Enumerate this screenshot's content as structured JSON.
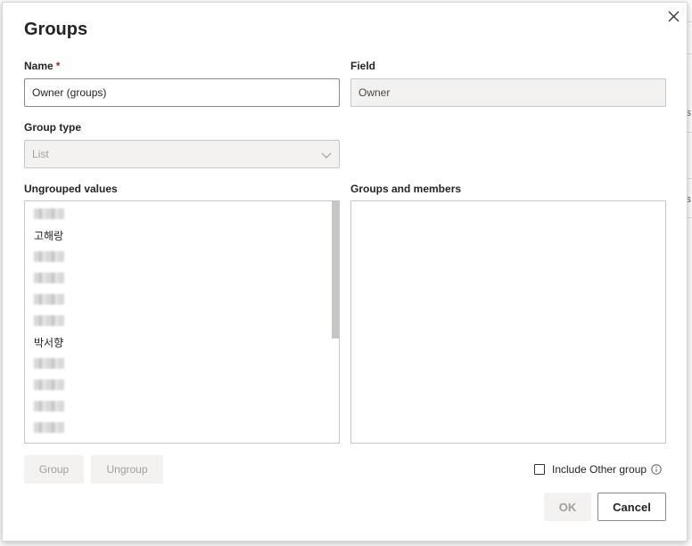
{
  "background": {
    "fragments": [
      "s",
      "s"
    ]
  },
  "dialog": {
    "title": "Groups",
    "name_label": "Name",
    "required_mark": "*",
    "name_value": "Owner (groups)",
    "field_label": "Field",
    "field_value": "Owner",
    "group_type_label": "Group type",
    "group_type_value": "List",
    "ungrouped_label": "Ungrouped values",
    "groups_members_label": "Groups and members",
    "ungrouped_items": [
      {
        "text": "",
        "redacted": true
      },
      {
        "text": "고해랑",
        "redacted": false
      },
      {
        "text": "",
        "redacted": true
      },
      {
        "text": "",
        "redacted": true
      },
      {
        "text": "",
        "redacted": true
      },
      {
        "text": "",
        "redacted": true
      },
      {
        "text": "박서향",
        "redacted": false
      },
      {
        "text": "",
        "redacted": true
      },
      {
        "text": "",
        "redacted": true
      },
      {
        "text": "",
        "redacted": true
      },
      {
        "text": "",
        "redacted": true
      }
    ],
    "group_button": "Group",
    "ungroup_button": "Ungroup",
    "include_other_label": "Include Other group",
    "include_other_checked": false,
    "ok_button": "OK",
    "cancel_button": "Cancel"
  },
  "colors": {
    "required": "#a4262c",
    "disabled_bg": "#f3f2f1",
    "disabled_text": "#a19f9d",
    "border": "#8a8886"
  },
  "icons": {
    "close": "close-icon",
    "dropdown": "chevron-down-icon",
    "info": "info-icon"
  }
}
